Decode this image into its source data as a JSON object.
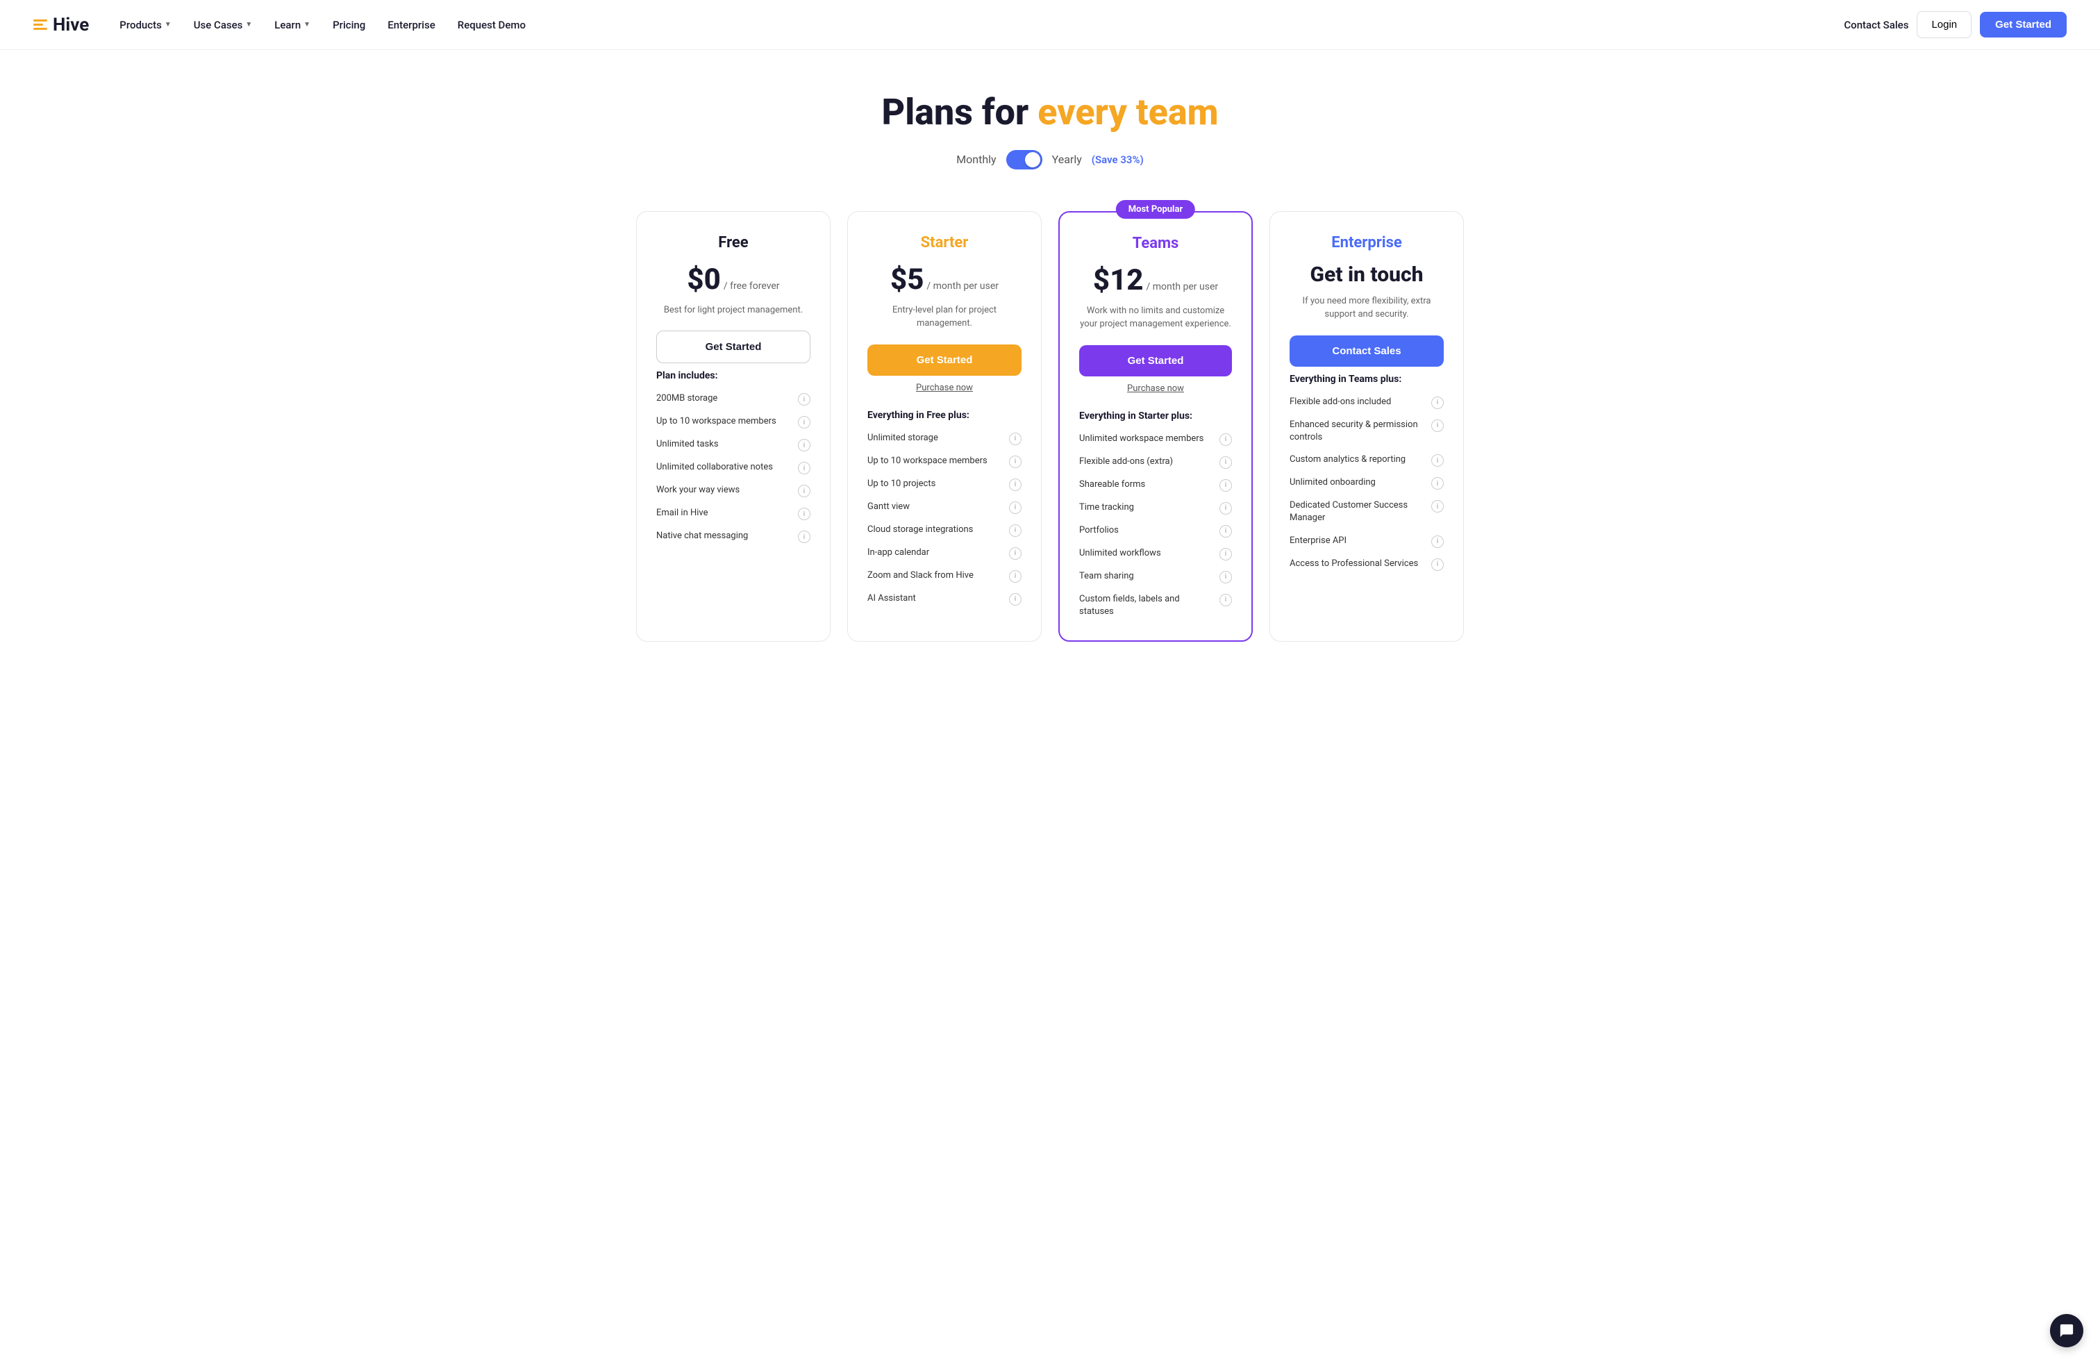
{
  "nav": {
    "logo_text": "Hive",
    "links": [
      {
        "label": "Products",
        "has_dropdown": true
      },
      {
        "label": "Use Cases",
        "has_dropdown": true
      },
      {
        "label": "Learn",
        "has_dropdown": true
      },
      {
        "label": "Pricing",
        "has_dropdown": false
      },
      {
        "label": "Enterprise",
        "has_dropdown": false
      },
      {
        "label": "Request Demo",
        "has_dropdown": false
      }
    ],
    "contact_sales": "Contact Sales",
    "login": "Login",
    "get_started": "Get Started"
  },
  "hero": {
    "title_part1": "Plans for ",
    "title_accent": "every team",
    "billing_monthly": "Monthly",
    "billing_yearly": "Yearly",
    "save_badge": "(Save 33%)"
  },
  "plans": [
    {
      "id": "free",
      "name": "Free",
      "name_class": "free",
      "price_symbol": "$",
      "price_amount": "0",
      "price_period": "/ free forever",
      "description": "Best for light project management.",
      "cta_label": "Get Started",
      "cta_class": "free-btn",
      "purchase_link": null,
      "section_label": "Plan includes:",
      "features": [
        "200MB storage",
        "Up to 10 workspace members",
        "Unlimited tasks",
        "Unlimited collaborative notes",
        "Work your way views",
        "Email in Hive",
        "Native chat messaging"
      ]
    },
    {
      "id": "starter",
      "name": "Starter",
      "name_class": "starter",
      "price_symbol": "$",
      "price_amount": "5",
      "price_period": "/ month per user",
      "description": "Entry-level plan for project management.",
      "cta_label": "Get Started",
      "cta_class": "starter-btn",
      "purchase_link": "Purchase now",
      "section_label": "Everything in Free plus:",
      "features": [
        "Unlimited storage",
        "Up to 10 workspace members",
        "Up to 10 projects",
        "Gantt view",
        "Cloud storage integrations",
        "In-app calendar",
        "Zoom and Slack from Hive",
        "AI Assistant"
      ]
    },
    {
      "id": "teams",
      "name": "Teams",
      "name_class": "teams",
      "popular": true,
      "popular_label": "Most Popular",
      "price_symbol": "$",
      "price_amount": "12",
      "price_period": "/ month per user",
      "description": "Work with no limits and customize your project management experience.",
      "cta_label": "Get Started",
      "cta_class": "teams-btn",
      "purchase_link": "Purchase now",
      "section_label": "Everything in Starter plus:",
      "features": [
        "Unlimited workspace members",
        "Flexible add-ons (extra)",
        "Shareable forms",
        "Time tracking",
        "Portfolios",
        "Unlimited workflows",
        "Team sharing",
        "Custom fields, labels and statuses"
      ]
    },
    {
      "id": "enterprise",
      "name": "Enterprise",
      "name_class": "enterprise",
      "price_big_text": "Get in touch",
      "description": "If you need more flexibility, extra support and security.",
      "cta_label": "Contact Sales",
      "cta_class": "enterprise-btn",
      "purchase_link": null,
      "section_label": "Everything in Teams plus:",
      "features": [
        "Flexible add-ons included",
        "Enhanced security & permission controls",
        "Custom analytics & reporting",
        "Unlimited onboarding",
        "Dedicated Customer Success Manager",
        "Enterprise API",
        "Access to Professional Services"
      ]
    }
  ]
}
